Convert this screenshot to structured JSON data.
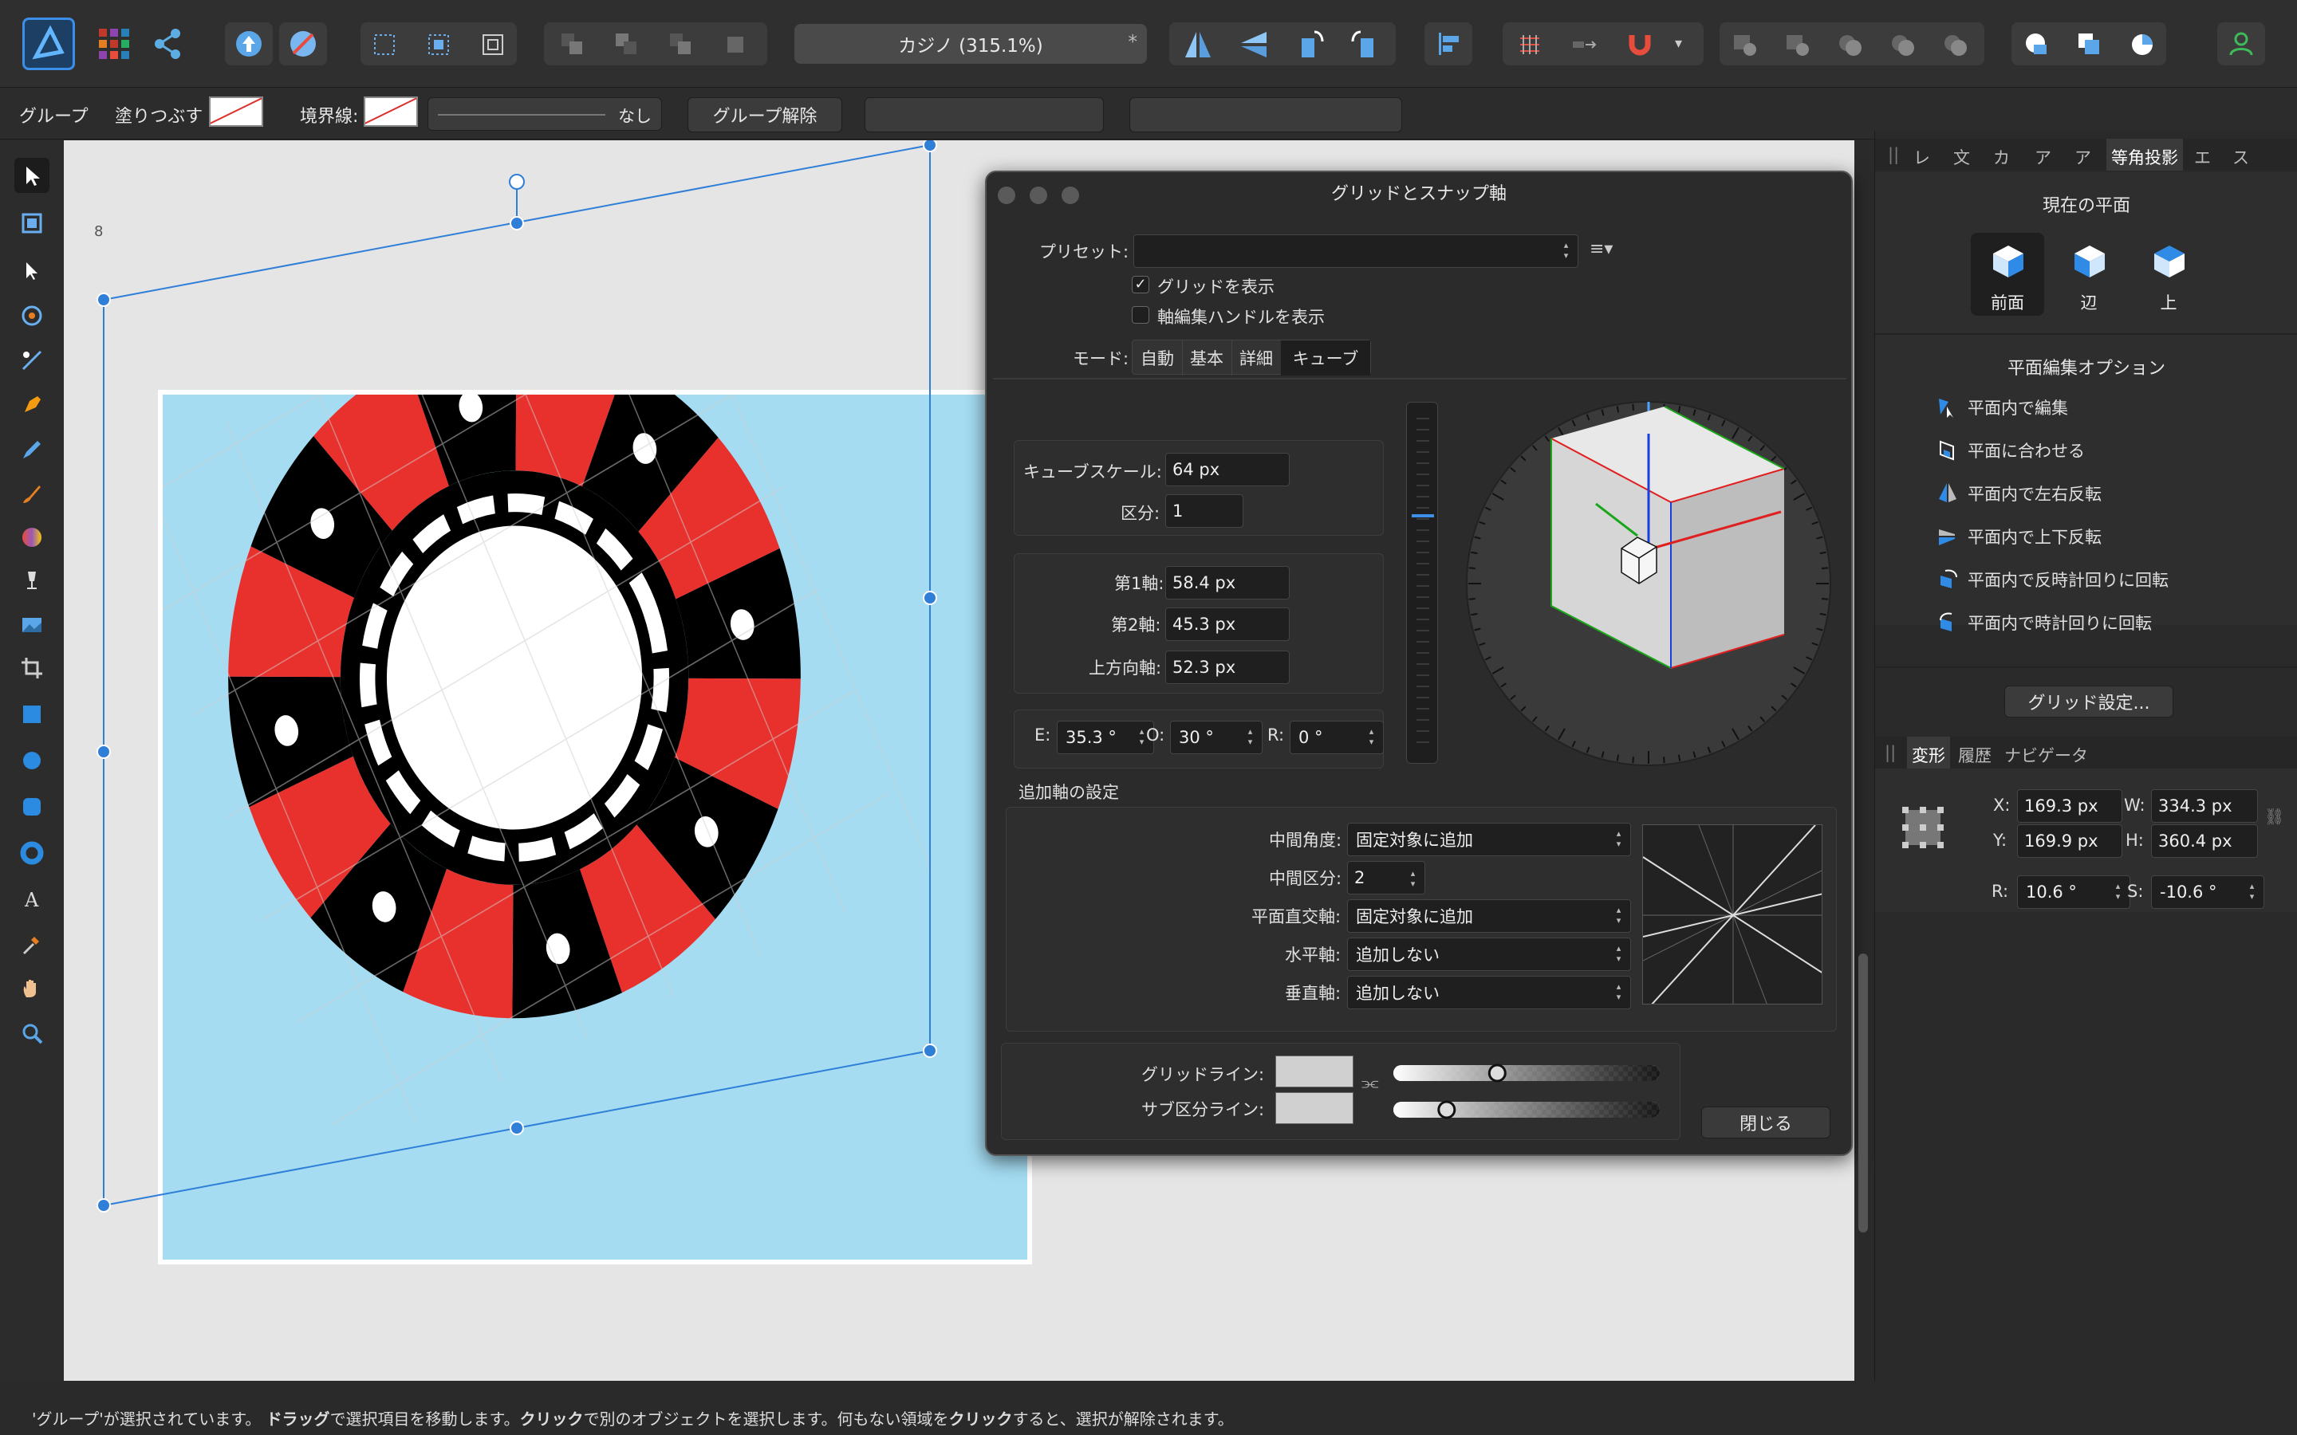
{
  "toolbar": {
    "document_title": "カジノ (315.1%)",
    "document_modified_marker": "*",
    "icons": [
      "affinity-designer-logo",
      "persona-grid-icon",
      "share-icon",
      "upload-icon",
      "no-entry-icon",
      "select-grid-icon",
      "select-bounds-icon",
      "select-object-icon",
      "order-back-icon",
      "order-backward-icon",
      "order-forward-icon",
      "order-front-icon",
      "flip-horizontal-icon",
      "flip-vertical-icon",
      "rotate-left-icon",
      "rotate-right-icon",
      "align-icon",
      "snap-grid-icon",
      "snap-icon",
      "magnet-icon",
      "add-icon",
      "subtract-icon",
      "intersect-icon",
      "xor-icon",
      "divide-icon",
      "combine-icon",
      "insert-back-icon",
      "insert-inside-icon",
      "user-icon"
    ]
  },
  "context": {
    "group_label": "グループ",
    "fill_label": "塗りつぶす",
    "stroke_label": "境界線:",
    "stroke_value": "なし",
    "ungroup_button": "グループ解除"
  },
  "canvas": {
    "ruler_mark": "8",
    "artboard_color": "#a5dcf2"
  },
  "dialog": {
    "title": "グリッドとスナップ軸",
    "preset_label": "プリセット:",
    "preset_value": "",
    "show_grid_label": "グリッドを表示",
    "show_grid_checked": "✓",
    "show_handles_label": "軸編集ハンドルを表示",
    "mode_label": "モード:",
    "modes": [
      "自動",
      "基本",
      "詳細",
      "キューブ"
    ],
    "active_mode": "キューブ",
    "cube_scale_label": "キューブスケール:",
    "cube_scale_value": "64 px",
    "division_label": "区分:",
    "division_value": "1",
    "axis1_label": "第1軸:",
    "axis1_value": "58.4 px",
    "axis2_label": "第2軸:",
    "axis2_value": "45.3 px",
    "up_label": "上方向軸:",
    "up_value": "52.3 px",
    "e_label": "E:",
    "e_value": "35.3 °",
    "o_label": "O:",
    "o_value": "30 °",
    "r_label": "R:",
    "r_value": "0 °",
    "extra_title": "追加軸の設定",
    "mid_angle_label": "中間角度:",
    "mid_angle_value": "固定対象に追加",
    "mid_div_label": "中間区分:",
    "mid_div_value": "2",
    "plane_perp_label": "平面直交軸:",
    "plane_perp_value": "固定対象に追加",
    "horizontal_label": "水平軸:",
    "horizontal_value": "追加しない",
    "vertical_label": "垂直軸:",
    "vertical_value": "追加しない",
    "gridline_label": "グリッドライン:",
    "subline_label": "サブ区分ライン:",
    "close_button": "閉じる",
    "gridline_opacity": 0.39,
    "subline_opacity": 0.2
  },
  "panel": {
    "tabs": [
      "レ",
      "文",
      "カ",
      "ア",
      "ア",
      "等角投影",
      "エ",
      "ス"
    ],
    "active_tab": "等角投影",
    "current_plane_title": "現在の平面",
    "planes": [
      "前面",
      "辺",
      "上"
    ],
    "active_plane": "前面",
    "edit_options_title": "平面編集オプション",
    "options": [
      "平面内で編集",
      "平面に合わせる",
      "平面内で左右反転",
      "平面内で上下反転",
      "平面内で反時計回りに回転",
      "平面内で時計回りに回転"
    ],
    "grid_settings_button": "グリッド設定...",
    "tabs2": [
      "変形",
      "履歴",
      "ナビゲータ"
    ],
    "active_tab2": "変形",
    "x_label": "X:",
    "x_value": "169.3 px",
    "y_label": "Y:",
    "y_value": "169.9 px",
    "w_label": "W:",
    "w_value": "334.3 px",
    "h_label": "H:",
    "h_value": "360.4 px",
    "r_label": "R:",
    "r_value": "10.6 °",
    "s_label": "S:",
    "s_value": "-10.6 °"
  },
  "status": {
    "part1": "'グループ'が選択されています。",
    "drag": "ドラッグ",
    "part2": "で選択項目を移動します。",
    "click": "クリック",
    "part3": "で別のオブジェクトを選択します。何もない領域を",
    "click2": "クリック",
    "part4": "すると、選択が解除されます。"
  },
  "colors": {
    "accent": "#2f7ed8",
    "chip_red": "#e8302c",
    "chip_black": "#000000"
  }
}
